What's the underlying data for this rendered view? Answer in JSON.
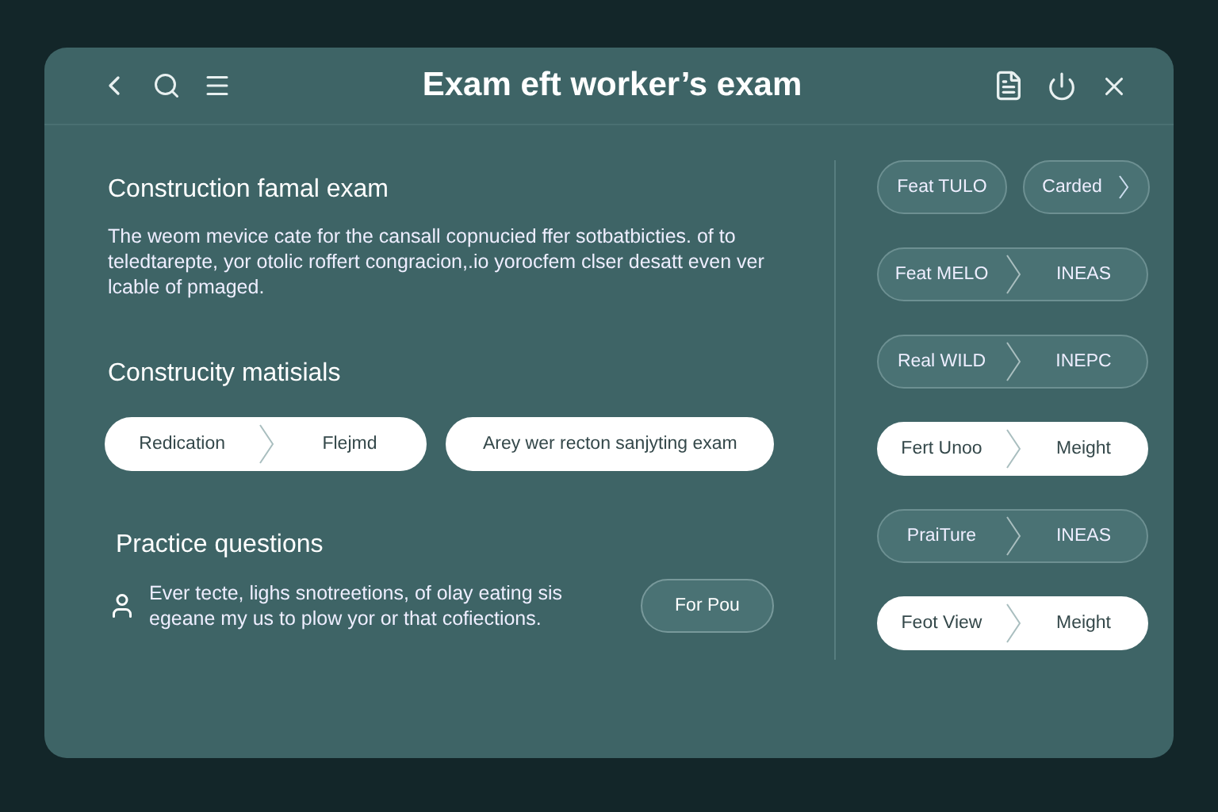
{
  "window": {
    "title": "Exam eft worker’s exam"
  },
  "sections": [
    {
      "title": "Construction famal exam",
      "body": "The weom mevice cate for the cansall copnucied ffer sotbatbicties. of to teledtarepte, yor otolic roffert congracion,.io yorocfem clser desatt even ver lcable of pmaged."
    },
    {
      "title": "Construcity matisials",
      "chips": [
        {
          "kind": "split",
          "left": "Redication",
          "right": "Flejmd",
          "selected": true
        },
        {
          "kind": "single",
          "label": "Arey wer recton sanjyting exam",
          "selected": true
        }
      ]
    },
    {
      "title": "Practice questions",
      "note": "Ever tecte, lighs snotreetions, of olay eating sis egeane my us to plow yor or that cofiections.",
      "button": "For Pou"
    }
  ],
  "right_pills": [
    {
      "kind": "pair",
      "left": "Feat TULO",
      "right": "Carded",
      "selected": false
    },
    {
      "kind": "split",
      "left": "Feat MELO",
      "right": "INEAS",
      "selected": false
    },
    {
      "kind": "split",
      "left": "Real WILD",
      "right": "INEPC",
      "selected": false
    },
    {
      "kind": "split",
      "left": "Fert Unoo",
      "right": "Meight",
      "selected": true
    },
    {
      "kind": "split",
      "left": "PraiTure",
      "right": "INEAS",
      "selected": false
    },
    {
      "kind": "split",
      "left": "Feot View",
      "right": "Meight",
      "selected": true
    }
  ]
}
